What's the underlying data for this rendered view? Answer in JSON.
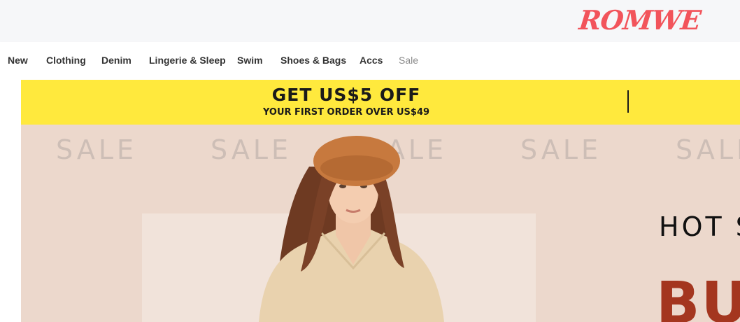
{
  "header": {
    "logo_text": "ROMWE"
  },
  "nav": {
    "items": [
      {
        "label": "New"
      },
      {
        "label": "Clothing"
      },
      {
        "label": "Denim"
      },
      {
        "label": "Lingerie & Sleep"
      },
      {
        "label": "Swim"
      },
      {
        "label": "Shoes & Bags"
      },
      {
        "label": "Accs"
      },
      {
        "label": "Sale"
      }
    ]
  },
  "promo": {
    "title": "GET US$5 OFF",
    "subtitle": "YOUR FIRST ORDER OVER US$49",
    "background": "#ffe93d"
  },
  "hero": {
    "sale_words": [
      "SALE",
      "SALE",
      "SALE",
      "SALE",
      "SALE"
    ],
    "headline": "HOT S",
    "big_text": "BU",
    "background": "#ecd8cc",
    "accent": "#a4361f"
  },
  "colors": {
    "brand": "#f2545b"
  }
}
